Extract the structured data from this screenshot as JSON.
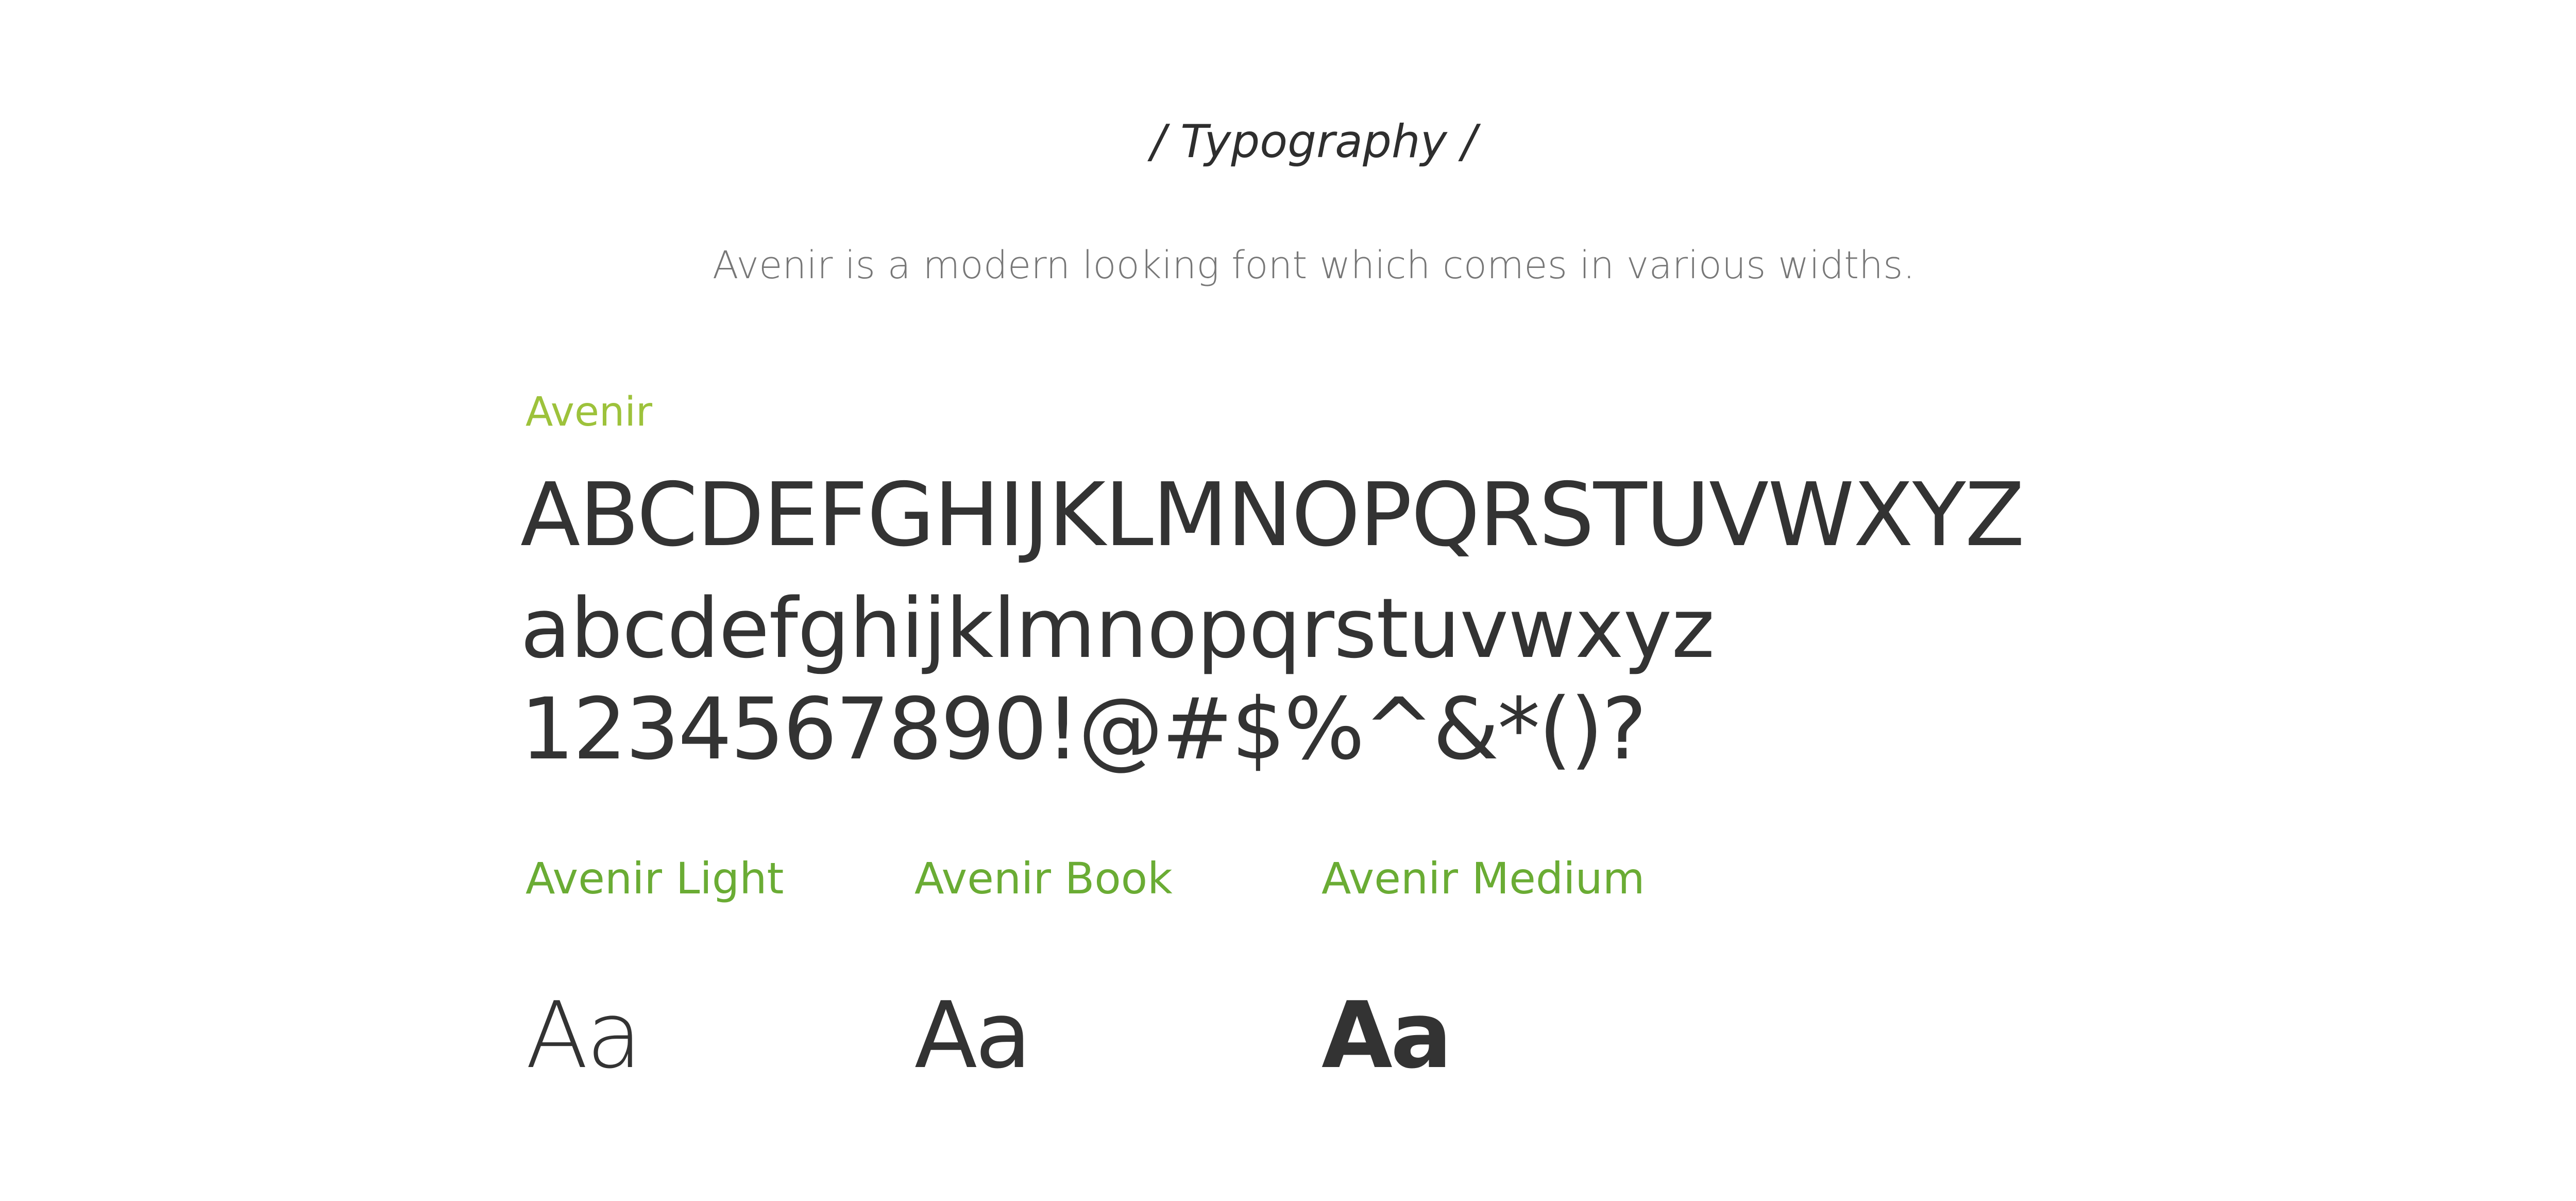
{
  "header": {
    "title": "/ Typography /",
    "description": "Avenir is a modern looking font which comes in various widths."
  },
  "font_family": {
    "label": "Avenir",
    "label_color": "#9dc23b",
    "uppercase": "ABCDEFGHIJKLMNOPQRSTUVWXYZ",
    "lowercase": "abcdefghijklmnopqrstuvwxyz",
    "digits_symbols": "1234567890!@#$%^&*()?"
  },
  "weights": [
    {
      "label": "Avenir Light",
      "sample": "Aa"
    },
    {
      "label": "Avenir Book",
      "sample": "Aa"
    },
    {
      "label": "Avenir Medium",
      "sample": "Aa"
    }
  ],
  "colors": {
    "weight_label": "#6aac34",
    "text_dark": "#333333",
    "text_muted": "#777777"
  }
}
